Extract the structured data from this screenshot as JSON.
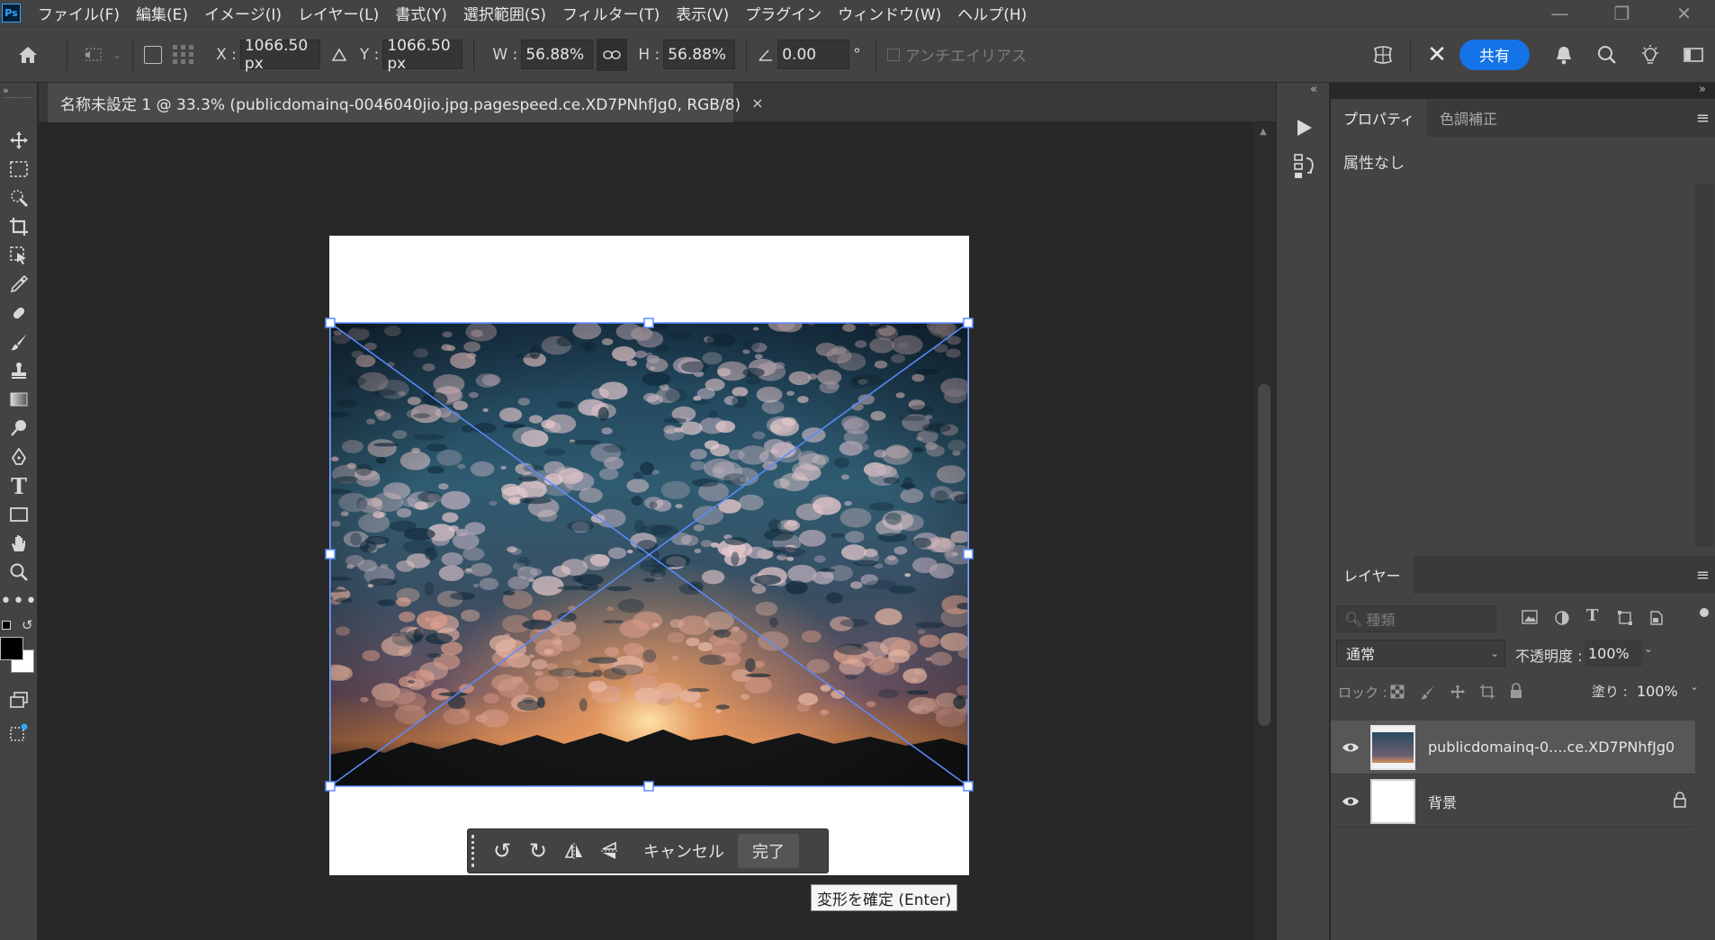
{
  "app": {
    "logo": "Ps"
  },
  "menu": [
    "ファイル(F)",
    "編集(E)",
    "イメージ(I)",
    "レイヤー(L)",
    "書式(Y)",
    "選択範囲(S)",
    "フィルター(T)",
    "表示(V)",
    "プラグイン",
    "ウィンドウ(W)",
    "ヘルプ(H)"
  ],
  "options": {
    "x_label": "X :",
    "x_value": "1066.50 px",
    "y_label": "Y :",
    "y_value": "1066.50 px",
    "w_label": "W :",
    "w_value": "56.88%",
    "h_label": "H :",
    "h_value": "56.88%",
    "angle_value": "0.00",
    "angle_unit": "°",
    "antialias_label": "アンチエイリアス",
    "share_label": "共有"
  },
  "document": {
    "tab_title": "名称未設定 1 @ 33.3% (publicdomainq-0046040jio.jpg.pagespeed.ce.XD7PNhfJg0, RGB/8)",
    "tab_close": "×"
  },
  "taskbar": {
    "cancel_label": "キャンセル",
    "done_label": "完了"
  },
  "tooltip": "変形を確定 (Enter)",
  "properties_panel": {
    "tabs": [
      "プロパティ",
      "色調補正"
    ],
    "content": "属性なし"
  },
  "layers_panel": {
    "tab": "レイヤー",
    "search_placeholder": "種類",
    "blend_mode": "通常",
    "opacity_label": "不透明度 :",
    "opacity_value": "100%",
    "lock_label": "ロック :",
    "fill_label": "塗り :",
    "fill_value": "100%",
    "layers": [
      {
        "name": "publicdomainq-0....ce.XD7PNhfJg0",
        "visible": true,
        "selected": true,
        "locked": false
      },
      {
        "name": "背景",
        "visible": true,
        "selected": false,
        "locked": true
      }
    ]
  },
  "colors": {
    "accent": "#1473e6",
    "transform_line": "#5b8cff",
    "panel_bg": "#434343",
    "canvas_bg": "#282828"
  }
}
